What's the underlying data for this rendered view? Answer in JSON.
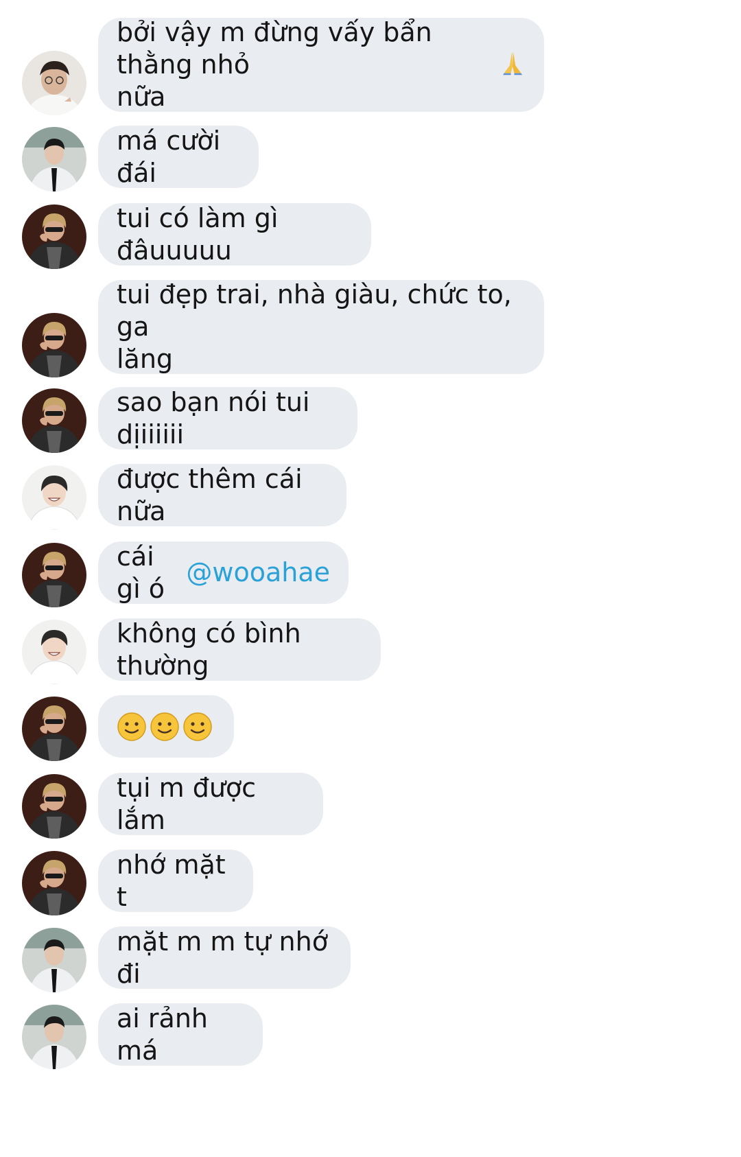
{
  "messages": [
    {
      "sender": "avatar-light",
      "text": "bởi vậy m đừng vấy bẩn thằng nhỏ\nnữa",
      "emoji": "folded-hands-icon"
    },
    {
      "sender": "avatar-suit",
      "text": "má cười đái"
    },
    {
      "sender": "avatar-blond",
      "text": "tui có làm gì đâuuuuu"
    },
    {
      "sender": "avatar-blond",
      "text": "tui đẹp trai, nhà giàu, chức to, ga\nlăng"
    },
    {
      "sender": "avatar-blond",
      "text": "sao bạn nói tui dịiiiiii"
    },
    {
      "sender": "avatar-smile",
      "text": "được thêm cái nữa"
    },
    {
      "sender": "avatar-blond",
      "text": "cái gì ó ",
      "mention": "@wooahae"
    },
    {
      "sender": "avatar-smile",
      "text": "không có bình thường"
    },
    {
      "sender": "avatar-blond",
      "emojis": [
        "slightly-smiling-face-icon",
        "slightly-smiling-face-icon",
        "slightly-smiling-face-icon"
      ]
    },
    {
      "sender": "avatar-blond",
      "text": "tụi m được lắm"
    },
    {
      "sender": "avatar-blond",
      "text": "nhớ mặt t"
    },
    {
      "sender": "avatar-suit",
      "text": "mặt m m tự nhớ đi"
    },
    {
      "sender": "avatar-suit",
      "text": "ai rảnh má"
    }
  ],
  "colors": {
    "bubble": "#e9ecf1",
    "text": "#151515",
    "mention": "#2aa2d8",
    "background": "#ffffff"
  }
}
